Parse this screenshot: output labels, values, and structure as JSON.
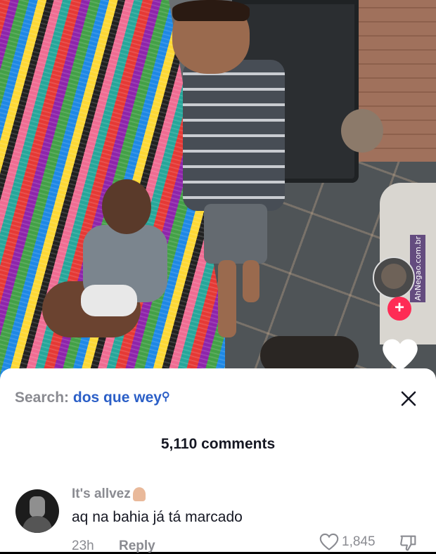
{
  "watermark": "AhNegao.com.br",
  "sheet": {
    "search_prefix": "Search:",
    "search_query": "dos que wey",
    "comment_count": "5,110 comments"
  },
  "comment": {
    "username": "It's allvez",
    "text": "aq na bahia já tá marcado",
    "time": "23h",
    "reply_label": "Reply",
    "likes": "1,845"
  },
  "colors": {
    "accent": "#fe2c55",
    "search_link": "#2b5fc7",
    "muted": "#8a8b91",
    "text": "#161823"
  }
}
